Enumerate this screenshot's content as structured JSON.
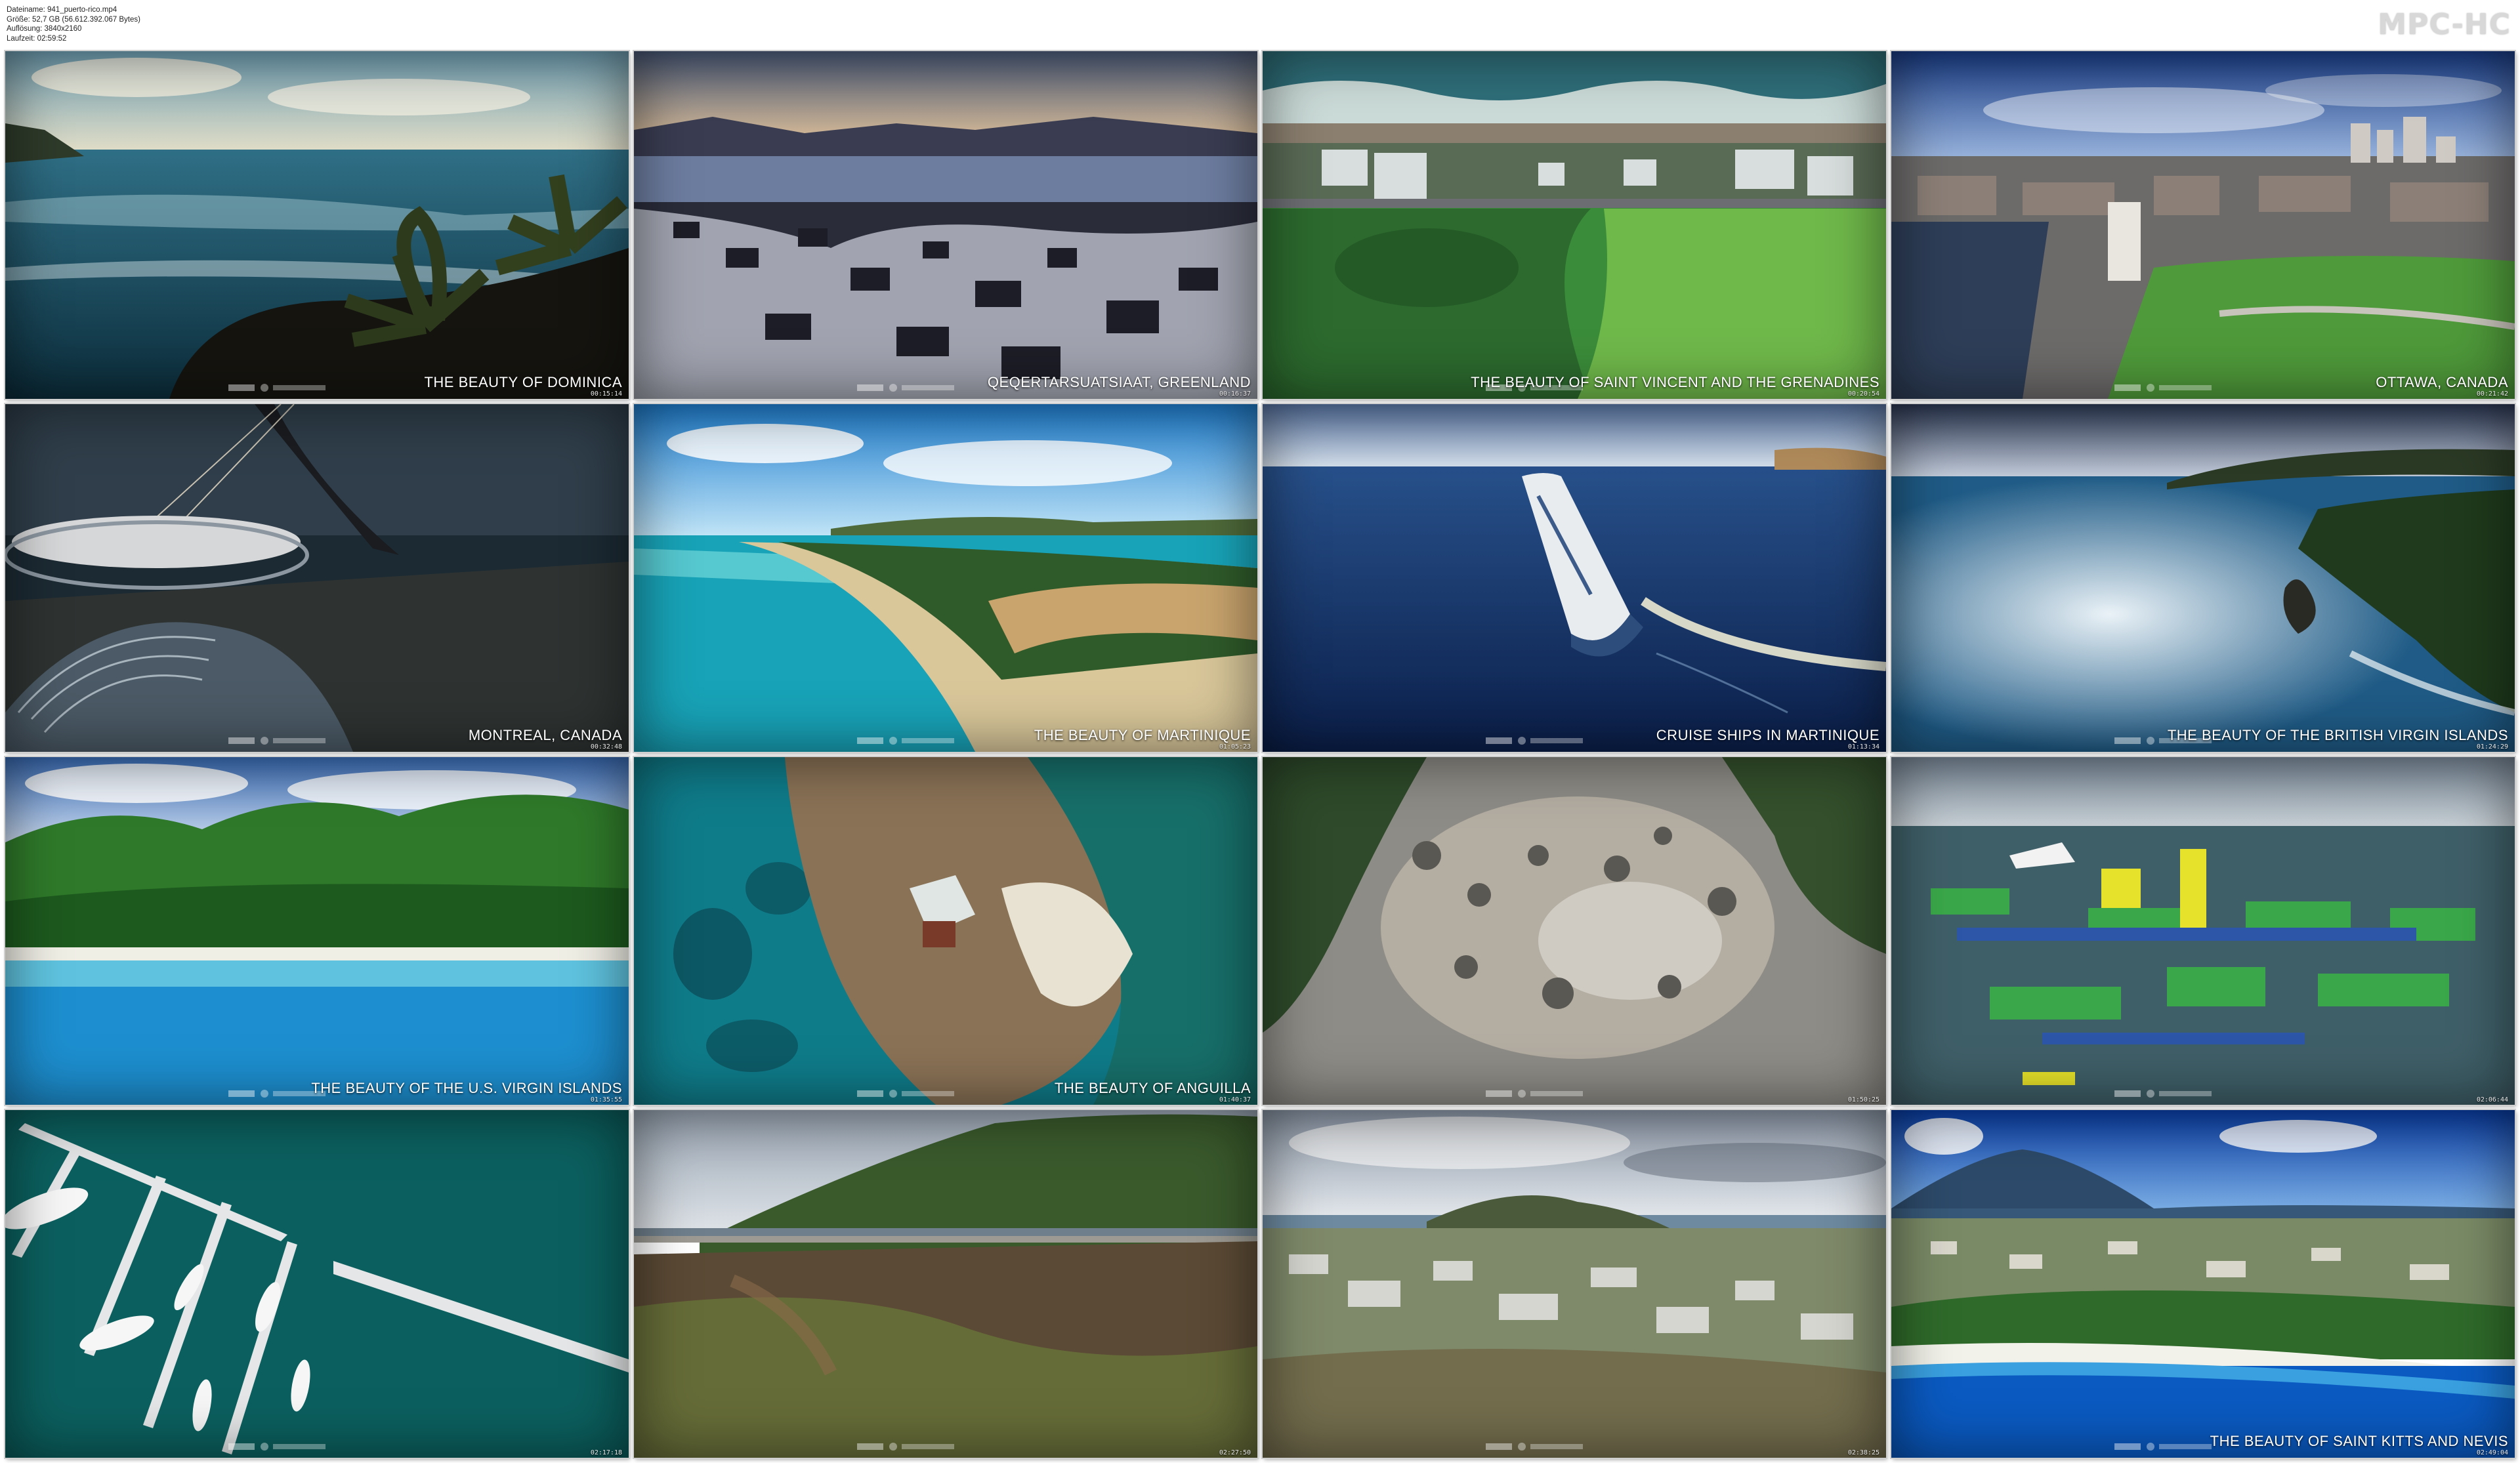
{
  "header": {
    "file_info": [
      "Dateiname: 941_puerto-rico.mp4",
      "Größe: 52,7 GB (56.612.392.067 Bytes)",
      "Auflösung: 3840x2160",
      "Laufzeit: 02:59:52"
    ],
    "brand": "MPC-HC"
  },
  "thumbnails": [
    {
      "caption": "The Beauty of Dominica",
      "time": "00:15:14",
      "scene": "sea-palms"
    },
    {
      "caption": "Qeqertarsuatsiaat, Greenland",
      "time": "00:16:37",
      "scene": "snow-village"
    },
    {
      "caption": "The Beauty of Saint Vincent and the Grenadines",
      "time": "00:20:54",
      "scene": "coast-aerial"
    },
    {
      "caption": "Ottawa, Canada",
      "time": "00:21:42",
      "scene": "city"
    },
    {
      "caption": "Montreal, Canada",
      "time": "00:32:48",
      "scene": "stadium"
    },
    {
      "caption": "The Beauty of Martinique",
      "time": "01:05:23",
      "scene": "beach"
    },
    {
      "caption": "Cruise Ships in Martinique",
      "time": "01:13:34",
      "scene": "cruise"
    },
    {
      "caption": "The Beauty of the British Virgin Islands",
      "time": "01:24:29",
      "scene": "cliffs"
    },
    {
      "caption": "The Beauty of the U.S. Virgin Islands",
      "time": "01:35:55",
      "scene": "green-hills"
    },
    {
      "caption": "The Beauty of Anguilla",
      "time": "01:40:37",
      "scene": "island-top"
    },
    {
      "caption": "",
      "time": "01:50:25",
      "scene": "volcanic"
    },
    {
      "caption": "",
      "time": "02:06:44",
      "scene": "waterpark"
    },
    {
      "caption": "",
      "time": "02:17:18",
      "scene": "marina"
    },
    {
      "caption": "",
      "time": "02:27:50",
      "scene": "hillside-road"
    },
    {
      "caption": "",
      "time": "02:38:25",
      "scene": "town-hill"
    },
    {
      "caption": "The Beauty of Saint Kitts and Nevis",
      "time": "02:49:04",
      "scene": "nevis"
    }
  ],
  "colors": {
    "brand": "#d8d8d8",
    "background": "#ffffff"
  }
}
